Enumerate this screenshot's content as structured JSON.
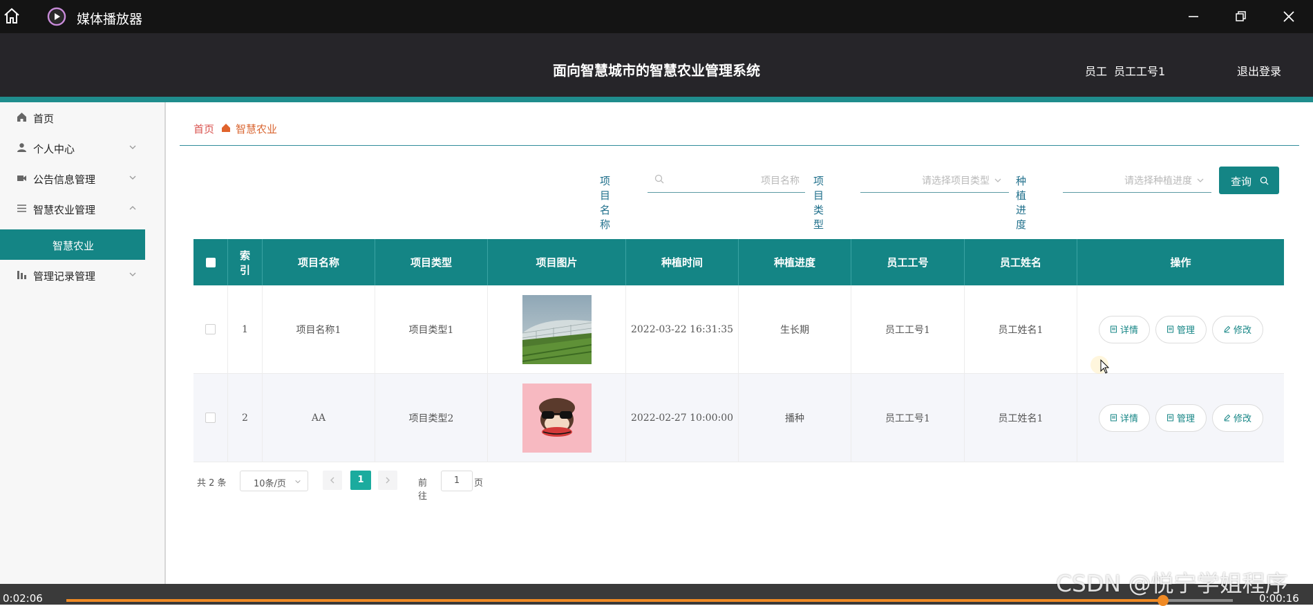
{
  "player": {
    "title": "媒体播放器",
    "time_elapsed": "0:02:06",
    "time_remaining": "0:00:16",
    "progress": 0.94,
    "accent": "#f08a24",
    "watermark": "CSDN @悦宁学姐程序"
  },
  "header": {
    "title": "面向智慧城市的智慧农业管理系统",
    "role": "员工",
    "user": "员工工号1",
    "logout": "退出登录"
  },
  "sidebar": {
    "items": [
      {
        "label": "首页",
        "icon": "home-icon"
      },
      {
        "label": "个人中心",
        "icon": "user-icon"
      },
      {
        "label": "公告信息管理",
        "icon": "notice-icon"
      },
      {
        "label": "智慧农业管理",
        "icon": "list-icon"
      },
      {
        "label": "智慧农业",
        "icon": ""
      },
      {
        "label": "管理记录管理",
        "icon": "chart-icon"
      }
    ]
  },
  "breadcrumb": {
    "home": "首页",
    "current": "智慧农业"
  },
  "search": {
    "name_label": "项目名称",
    "name_placeholder": "项目名称",
    "type_label": "项目类型",
    "type_placeholder": "请选择项目类型",
    "progress_label": "种植进度",
    "progress_placeholder": "请选择种植进度",
    "query_label": "查询"
  },
  "table": {
    "columns": [
      "索引",
      "项目名称",
      "项目类型",
      "项目图片",
      "种植时间",
      "种植进度",
      "员工工号",
      "员工姓名",
      "操作"
    ],
    "rows": [
      {
        "index": "1",
        "name": "项目名称1",
        "type": "项目类型1",
        "image": "greenhouse-photo",
        "time": "2022-03-22 16:31:35",
        "progress": "生长期",
        "emp_no": "员工工号1",
        "emp_name": "员工姓名1"
      },
      {
        "index": "2",
        "name": "AA",
        "type": "项目类型2",
        "image": "monkey-cartoon",
        "time": "2022-02-27 10:00:00",
        "progress": "播种",
        "emp_no": "员工工号1",
        "emp_name": "员工姓名1"
      }
    ],
    "actions": {
      "detail": "详情",
      "manage": "管理",
      "edit": "修改"
    }
  },
  "pagination": {
    "total": "共 2 条",
    "page_size": "10条/页",
    "current": "1",
    "goto_label": "前往",
    "goto_value": "1",
    "page_suffix": "页"
  },
  "colors": {
    "teal": "#148585",
    "header_bg": "#262529",
    "crumb_home": "#d9534f",
    "crumb_current": "#d96530"
  }
}
